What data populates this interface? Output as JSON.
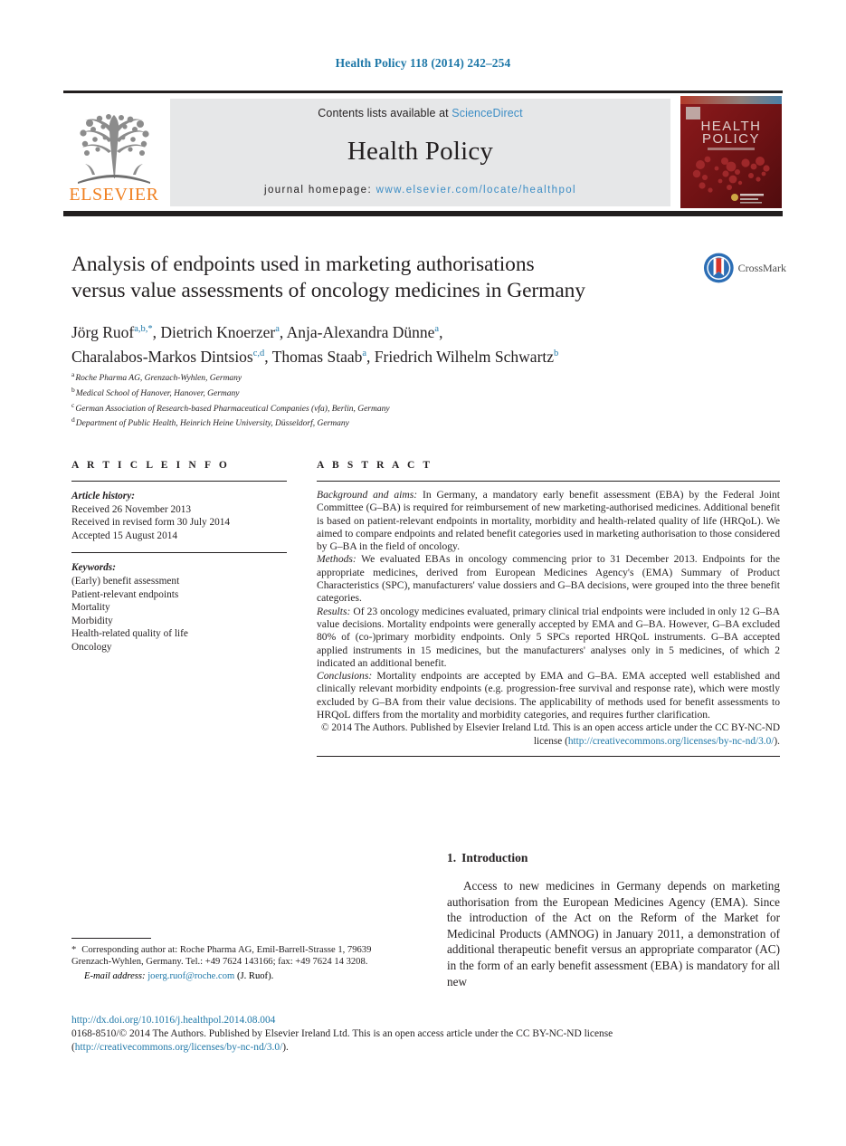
{
  "running_head": "Health Policy 118 (2014) 242–254",
  "masthead": {
    "contents_prefix": "Contents lists available at ",
    "sciencedirect": "ScienceDirect",
    "journal_name": "Health Policy",
    "homepage_label": "journal homepage:",
    "homepage_url": "www.elsevier.com/locate/healthpol",
    "publisher_logo_text": "ELSEVIER",
    "cover_title_line1": "HEALTH",
    "cover_title_line2": "POLICY"
  },
  "article": {
    "title_line1": "Analysis of endpoints used in marketing authorisations",
    "title_line2": "versus value assessments of oncology medicines in Germany",
    "crossmark_label": "CrossMark",
    "authors_line1": "Jörg Ruof",
    "authors": [
      {
        "name": "Jörg Ruof",
        "marks": "a,b,*"
      },
      {
        "name": "Dietrich Knoerzer",
        "marks": "a"
      },
      {
        "name": "Anja-Alexandra Dünne",
        "marks": "a"
      },
      {
        "name": "Charalabos-Markos Dintsios",
        "marks": "c,d"
      },
      {
        "name": "Thomas Staab",
        "marks": "a"
      },
      {
        "name": "Friedrich Wilhelm Schwartz",
        "marks": "b"
      }
    ],
    "affiliations": [
      {
        "mark": "a",
        "text": "Roche Pharma AG, Grenzach-Wyhlen, Germany"
      },
      {
        "mark": "b",
        "text": "Medical School of Hanover, Hanover, Germany"
      },
      {
        "mark": "c",
        "text": "German Association of Research-based Pharmaceutical Companies (vfa), Berlin, Germany"
      },
      {
        "mark": "d",
        "text": "Department of Public Health, Heinrich Heine University, Düsseldorf, Germany"
      }
    ]
  },
  "article_info": {
    "heading": "A R T I C L E   I N F O",
    "history_label": "Article history:",
    "history": [
      "Received 26 November 2013",
      "Received in revised form 30 July 2014",
      "Accepted 15 August 2014"
    ],
    "keywords_label": "Keywords:",
    "keywords": [
      "(Early) benefit assessment",
      "Patient-relevant endpoints",
      "Mortality",
      "Morbidity",
      "Health-related quality of life",
      "Oncology"
    ]
  },
  "abstract": {
    "heading": "A B S T R A C T",
    "paragraphs": [
      {
        "run_in": "Background and aims:",
        "text": " In Germany, a mandatory early benefit assessment (EBA) by the Federal Joint Committee (G–BA) is required for reimbursement of new marketing-authorised medicines. Additional benefit is based on patient-relevant endpoints in mortality, morbidity and health-related quality of life (HRQoL). We aimed to compare endpoints and related benefit categories used in marketing authorisation to those considered by G–BA in the field of oncology."
      },
      {
        "run_in": "Methods:",
        "text": " We evaluated EBAs in oncology commencing prior to 31 December 2013. Endpoints for the appropriate medicines, derived from European Medicines Agency's (EMA) Summary of Product Characteristics (SPC), manufacturers' value dossiers and G–BA decisions, were grouped into the three benefit categories."
      },
      {
        "run_in": "Results:",
        "text": " Of 23 oncology medicines evaluated, primary clinical trial endpoints were included in only 12 G–BA value decisions. Mortality endpoints were generally accepted by EMA and G–BA. However, G–BA excluded 80% of (co-)primary morbidity endpoints. Only 5 SPCs reported HRQoL instruments. G–BA accepted applied instruments in 15 medicines, but the manufacturers' analyses only in 5 medicines, of which 2 indicated an additional benefit."
      },
      {
        "run_in": "Conclusions:",
        "text": " Mortality endpoints are accepted by EMA and G–BA. EMA accepted well established and clinically relevant morbidity endpoints (e.g. progression-free survival and response rate), which were mostly excluded by G–BA from their value decisions. The applicability of methods used for benefit assessments to HRQoL differs from the mortality and morbidity categories, and requires further clarification."
      }
    ],
    "copyright_text": "© 2014 The Authors. Published by Elsevier Ireland Ltd. This is an open access article under the CC BY-NC-ND license (",
    "copyright_link": "http://creativecommons.org/licenses/by-nc-nd/3.0/",
    "copyright_tail": ")."
  },
  "body": {
    "section_number": "1.",
    "section_title": "Introduction",
    "intro_paragraph": "Access to new medicines in Germany depends on marketing authorisation from the European Medicines Agency (EMA). Since the introduction of the Act on the Reform of the Market for Medicinal Products (AMNOG) in January 2011, a demonstration of additional therapeutic benefit versus an appropriate comparator (AC) in the form of an early benefit assessment (EBA) is mandatory for all new"
  },
  "footnote": {
    "star": "*",
    "corresponding": "Corresponding author at: Roche Pharma AG, Emil-Barrell-Strasse 1, 79639 Grenzach-Wyhlen, Germany. Tel.: +49 7624 143166; fax: +49 7624 14 3208.",
    "email_label": "E-mail address:",
    "email": "joerg.ruof@roche.com",
    "email_owner": "(J. Ruof)."
  },
  "page_footer": {
    "doi": "http://dx.doi.org/10.1016/j.healthpol.2014.08.004",
    "license_text": "0168-8510/© 2014 The Authors. Published by Elsevier Ireland Ltd. This is an open access article under the CC BY-NC-ND license",
    "license_link_open": "(",
    "license_link": "http://creativecommons.org/licenses/by-nc-nd/3.0/",
    "license_link_close": ")."
  },
  "colors": {
    "link_blue": "#1f78a8",
    "sciencedirect_blue": "#3c8dc5",
    "rule_black": "#221f1f",
    "band_gray": "#e6e7e8",
    "elsevier_orange": "#f08021",
    "cover_red": "#7d1416"
  }
}
